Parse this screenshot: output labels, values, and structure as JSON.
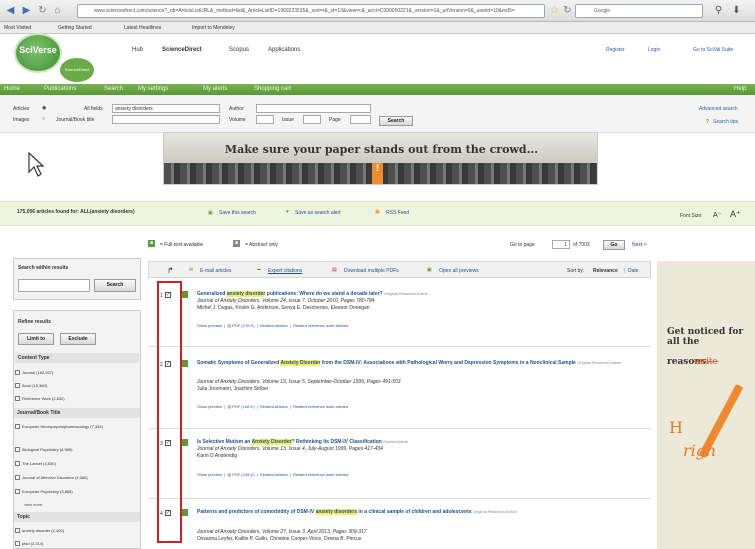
{
  "browser": {
    "url": "www.sciencedirect.com/science?_ob=ArticleListURL&_method=list&_ArticleListID=1969223535&_sort=r&_st=13&view=c&_acct=C000050221&_version=1&_urlVersion=0&_userid=10&md5=",
    "search_engine": "Google",
    "bookmarks": [
      "Most Visited",
      "Getting Started",
      "Latest Headlines",
      "Import to Mendeley"
    ]
  },
  "header": {
    "logo": "SciVerse",
    "logo_sub": "ScienceDirect",
    "nav": [
      "Hub",
      "ScienceDirect",
      "Scopus",
      "Applications"
    ],
    "user_links": [
      "Register",
      "Login",
      "Go to SciVal Suite"
    ]
  },
  "greenbar": {
    "tabs": [
      "Home",
      "Publications",
      "Search",
      "My settings",
      "My alerts",
      "Shopping cart"
    ],
    "help": "Help"
  },
  "search_form": {
    "articles_label": "Articles",
    "images_label": "Images",
    "all_fields_label": "All fields",
    "all_fields_value": "anxiety disorders",
    "journal_label": "Journal/Book title",
    "author_label": "Author",
    "volume_label": "Volume",
    "issue_label": "Issue",
    "page_label": "Page",
    "search_button": "Search",
    "advanced_search": "Advanced search",
    "search_tips": "Search tips"
  },
  "banner": {
    "text": "Make sure your paper stands out from the crowd...",
    "mark": "!"
  },
  "results_bar": {
    "summary": "175,056 articles found for: ALL(anxiety disorders)",
    "save_search": "Save this search",
    "save_alert": "Save as search alert",
    "rss": "RSS Feed",
    "font_size": "Font Size:"
  },
  "legend": {
    "full_text": "= Full-text available",
    "abstract": "= Abstract only"
  },
  "pagination": {
    "label": "Go to page",
    "page": "1",
    "of": "of 7003",
    "go": "Go",
    "next": "Next >"
  },
  "sidebar": {
    "search_within": "Search within results",
    "search_button": "Search",
    "refine": "Refine results",
    "limit_to": "Limit to",
    "exclude": "Exclude",
    "content_type_title": "Content Type",
    "content_types": [
      "Journal (162,007)",
      "Book (15,360)",
      "Reference Work (2,832)"
    ],
    "journal_title": "Journal/Book Title",
    "journals": [
      "European Neuropsychopharmacology (7,354)",
      "Biological Psychiatry (6,985)",
      "The Lancet (4,530)",
      "Journal of Affective Disorders (4,085)",
      "European Psychiatry (3,868)"
    ],
    "view_more": "view more",
    "topic_title": "Topic",
    "topics": [
      "anxiety disorder (2,400)",
      "ptsd (2,314)"
    ]
  },
  "toolbar": {
    "email": "E-mail articles",
    "export": "Export citations",
    "download": "Download multiple PDFs",
    "open_previews": "Open all previews",
    "sort_by": "Sort by:",
    "relevance": "Relevance",
    "date": "Date"
  },
  "results": [
    {
      "num": "1",
      "title_pre": "Generalized ",
      "title_hl": "anxiety disorder",
      "title_post": " publications: Where do we stand a decade later?",
      "tag": "Original Research Article",
      "journal": "Journal of Anxiety Disorders, Volume 24, Issue 7, October 2010, Pages 780-784",
      "authors": "Michel J. Dugas, Kristin G. Anderson, Sonya E. Deschenes, Eleanor Donegan",
      "pdf": "PDF (176 K)"
    },
    {
      "num": "2",
      "title_pre": "Somatic Symptoms of Generalized ",
      "title_hl": "Anxiety Disorder",
      "title_post": " from the DSM-IV: Associations with Pathological Worry and Depression Symptoms in a Nonclinical Sample",
      "tag": "Original Research Article",
      "journal": "Journal of Anxiety Disorders, Volume 13, Issue 5, September-October 1999, Pages 491-503",
      "authors": "Julia Joormann, Joachim Stöber",
      "pdf": "PDF (108 K)"
    },
    {
      "num": "3",
      "title_pre": "Is Selective Mutism an ",
      "title_hl": "Anxiety Disorder",
      "title_post": "? Rethinking Its DSM-IV Classification",
      "tag": "Review Article",
      "journal": "Journal of Anxiety Disorders, Volume 13, Issue 4, July-August 1999, Pages 417-434",
      "authors": "Karin D Anstendig",
      "pdf": "PDF (135 K)"
    },
    {
      "num": "4",
      "title_pre": "Patterns and predictors of comorbidity of DSM-IV ",
      "title_hl": "anxiety disorders",
      "title_post": " in a clinical sample of children and adolescents",
      "tag": "Original Research Article",
      "journal": "Journal of Anxiety Disorders, Volume 27, Issue 3, April 2013, Pages 309-317",
      "authors": "Ovsanna Leyfer, Kaitlin P. Gallo, Christine Cooper-Vince, Donna B. Pincus",
      "pdf": ""
    }
  ],
  "result_links": {
    "preview": "Show preview",
    "related": "Related articles",
    "related_ref": "Related reference work articles"
  },
  "ad": {
    "text": "Get noticed for all the",
    "strike": "write",
    "text2": "reasons.",
    "hand1": "H",
    "hand2": "righ"
  }
}
